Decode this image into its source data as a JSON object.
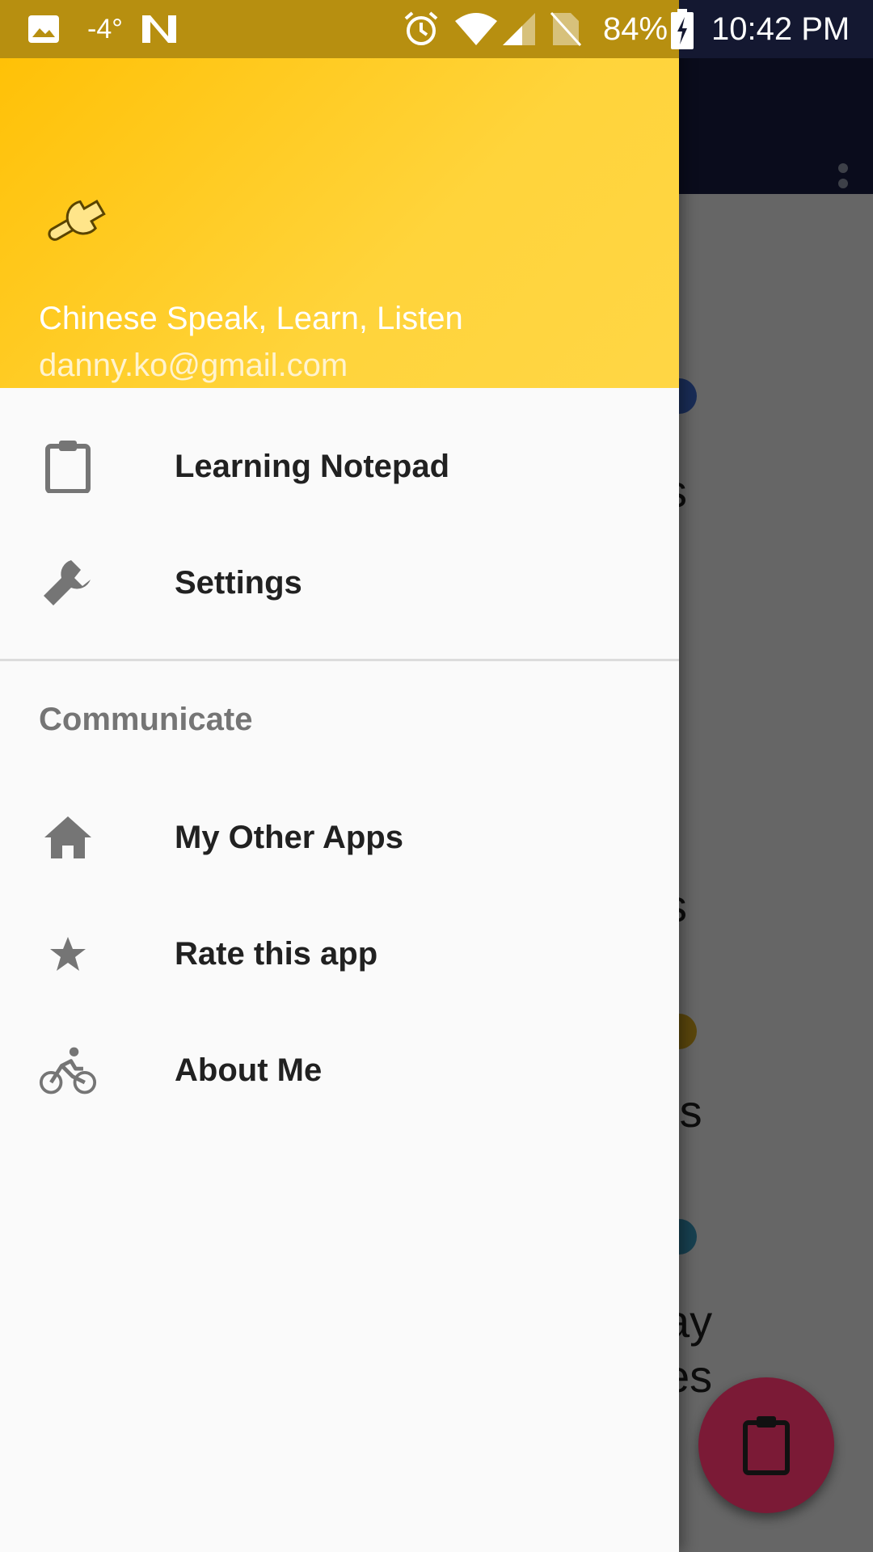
{
  "status_bar": {
    "temperature": "-4°",
    "battery": "84%",
    "time": "10:42 PM",
    "icons": [
      "image-icon",
      "notification-n-icon",
      "alarm-icon",
      "wifi-icon",
      "signal-icon",
      "no-sim-icon",
      "battery-charging-icon"
    ]
  },
  "background": {
    "fragments": [
      "s",
      "s",
      "rs",
      "ay",
      "es"
    ]
  },
  "drawer": {
    "header": {
      "title": "Chinese Speak, Learn, Listen",
      "email": "danny.ko@gmail.com",
      "logo_icon": "wrench-logo-icon"
    },
    "items": [
      {
        "label": "Learning Notepad",
        "icon": "clipboard-icon"
      },
      {
        "label": "Settings",
        "icon": "wrench-icon"
      }
    ],
    "section": {
      "title": "Communicate",
      "items": [
        {
          "label": "My Other Apps",
          "icon": "home-icon"
        },
        {
          "label": "Rate this app",
          "icon": "star-icon"
        },
        {
          "label": "About Me",
          "icon": "bike-icon"
        }
      ]
    }
  },
  "colors": {
    "header_yellow": "#ffc107",
    "toolbar": "#1b2047",
    "fab": "#7b1a36"
  }
}
